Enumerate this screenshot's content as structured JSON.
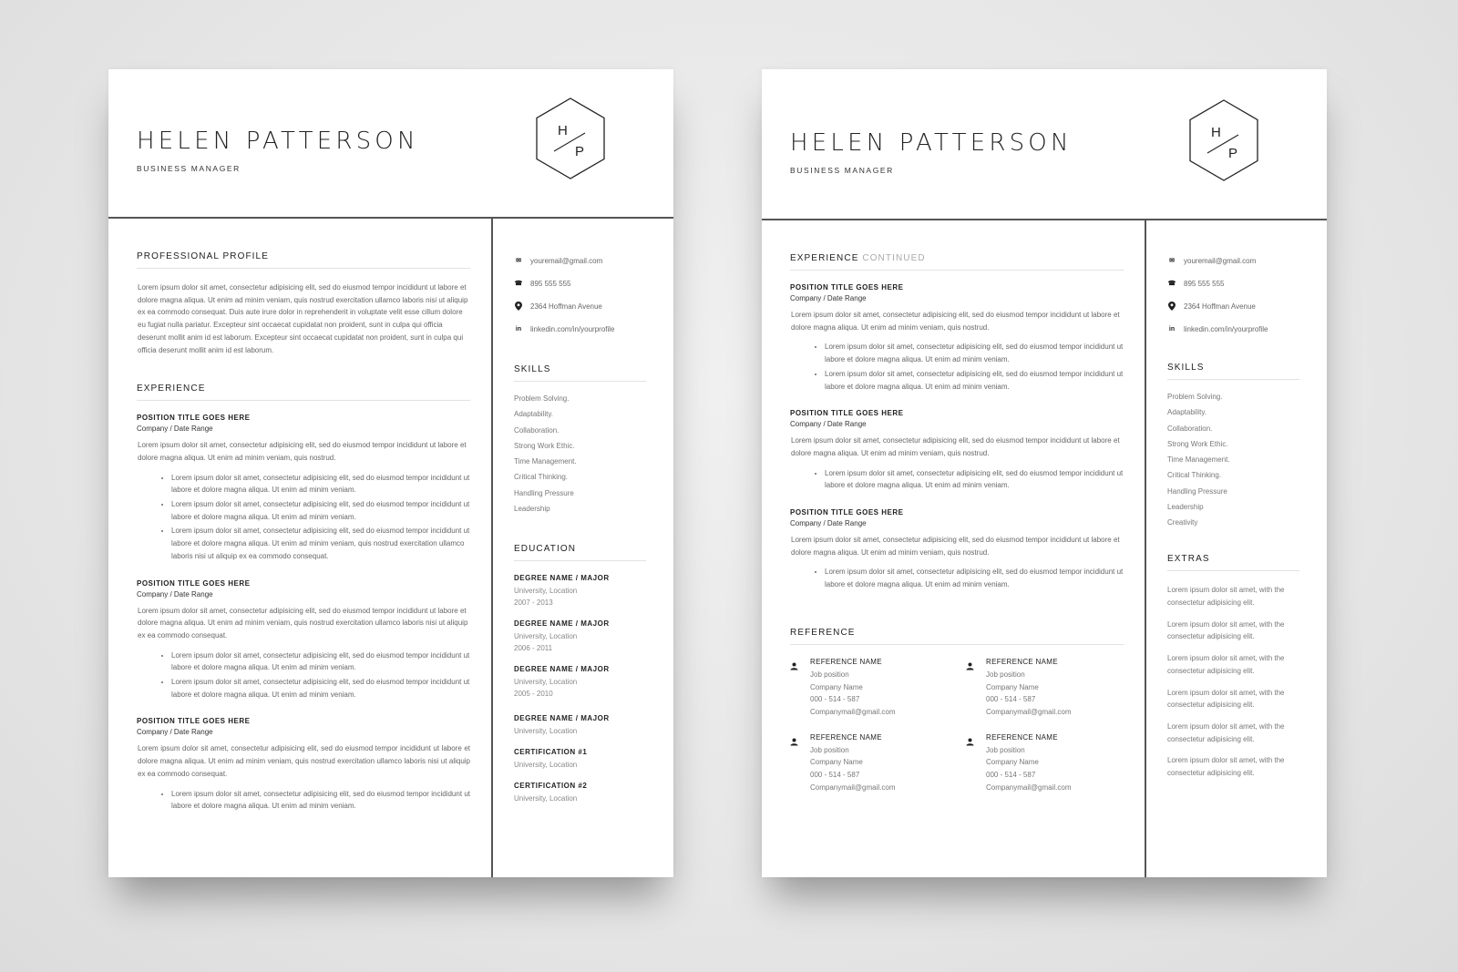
{
  "header": {
    "name": "HELEN PATTERSON",
    "role": "BUSINESS MANAGER",
    "monogram": {
      "first": "H",
      "second": "P"
    }
  },
  "contact": [
    {
      "icon": "email-icon",
      "glyph": "✉",
      "text": "youremail@gmail.com"
    },
    {
      "icon": "phone-icon",
      "glyph": "☎",
      "text": "895 555 555"
    },
    {
      "icon": "location-pin-icon",
      "glyph": "⬤",
      "text": "2364 Hoffman Avenue"
    },
    {
      "icon": "linkedin-icon",
      "glyph": "in",
      "text": "linkedin.com/in/yourprofile"
    }
  ],
  "page1": {
    "profile": {
      "title": "PROFESSIONAL PROFILE",
      "text": "Lorem ipsum dolor sit amet, consectetur adipisicing elit, sed do eiusmod tempor incididunt ut labore et dolore magna aliqua. Ut enim ad minim veniam, quis nostrud exercitation ullamco laboris nisi ut aliquip ex ea commodo consequat. Duis aute irure dolor in reprehenderit in voluptate velit esse cillum dolore eu fugiat nulla pariatur. Excepteur sint occaecat cupidatat non proident, sunt in culpa qui officia deserunt mollit anim id est laborum. Excepteur sint occaecat cupidatat non proident, sunt in culpa qui officia deserunt mollit anim id est laborum."
    },
    "experience": {
      "title": "EXPERIENCE",
      "jobs": [
        {
          "title": "POSITION TITLE GOES HERE",
          "company": "Company / Date Range",
          "summary": "Lorem ipsum dolor sit amet, consectetur adipisicing elit, sed do eiusmod tempor incididunt ut labore et dolore magna aliqua. Ut enim ad minim veniam, quis nostrud.",
          "bullets": [
            "Lorem ipsum dolor sit amet, consectetur adipisicing elit, sed do eiusmod tempor incididunt ut labore et dolore magna aliqua. Ut enim ad minim veniam.",
            "Lorem ipsum dolor sit amet, consectetur adipisicing elit, sed do eiusmod tempor incididunt ut labore et dolore magna aliqua. Ut enim ad minim veniam.",
            "Lorem ipsum dolor sit amet, consectetur adipisicing elit, sed do eiusmod tempor incididunt ut labore et dolore magna aliqua. Ut enim ad minim veniam, quis nostrud exercitation ullamco laboris nisi ut aliquip ex ea commodo consequat."
          ]
        },
        {
          "title": "POSITION TITLE GOES HERE",
          "company": "Company / Date Range",
          "summary": "Lorem ipsum dolor sit amet, consectetur adipisicing elit, sed do eiusmod tempor incididunt ut labore et dolore magna aliqua. Ut enim ad minim veniam, quis nostrud exercitation ullamco laboris nisi ut aliquip ex ea commodo consequat.",
          "bullets": [
            "Lorem ipsum dolor sit amet, consectetur adipisicing elit, sed do eiusmod tempor incididunt ut labore et dolore magna aliqua. Ut enim ad minim veniam.",
            "Lorem ipsum dolor sit amet, consectetur adipisicing elit, sed do eiusmod tempor incididunt ut labore et dolore magna aliqua. Ut enim ad minim veniam."
          ]
        },
        {
          "title": "POSITION TITLE GOES HERE",
          "company": "Company / Date Range",
          "summary": "Lorem ipsum dolor sit amet, consectetur adipisicing elit, sed do eiusmod tempor incididunt ut labore et dolore magna aliqua. Ut enim ad minim veniam, quis nostrud exercitation ullamco laboris nisi ut aliquip ex ea commodo consequat.",
          "bullets": [
            "Lorem ipsum dolor sit amet, consectetur adipisicing elit, sed do eiusmod tempor incididunt ut labore et dolore magna aliqua. Ut enim ad minim veniam."
          ]
        }
      ]
    },
    "skills": {
      "title": "SKILLS",
      "items": [
        "Problem Solving.",
        "Adaptability.",
        "Collaboration.",
        "Strong Work Ethic.",
        "Time Management.",
        "Critical Thinking.",
        "Handling Pressure",
        "Leadership"
      ]
    },
    "education": {
      "title": "EDUCATION",
      "items": [
        {
          "title": "DEGREE NAME / MAJOR",
          "lines": [
            "University, Location",
            "2007 - 2013"
          ]
        },
        {
          "title": "DEGREE NAME / MAJOR",
          "lines": [
            "University, Location",
            "2006 - 2011"
          ]
        },
        {
          "title": "DEGREE NAME / MAJOR",
          "lines": [
            "University, Location",
            "2005 - 2010"
          ]
        },
        {
          "title": "DEGREE NAME / MAJOR",
          "lines": [
            "University, Location"
          ]
        },
        {
          "title": "CERTIFICATION #1",
          "lines": [
            "University, Location"
          ]
        },
        {
          "title": "CERTIFICATION #2",
          "lines": [
            "University, Location"
          ]
        }
      ]
    }
  },
  "page2": {
    "experience": {
      "title": "EXPERIENCE",
      "title_suffix": "CONTINUED",
      "jobs": [
        {
          "title": "POSITION TITLE GOES HERE",
          "company": "Company / Date Range",
          "summary": "Lorem ipsum dolor sit amet, consectetur adipisicing elit, sed do eiusmod tempor incididunt ut labore et dolore magna aliqua. Ut enim ad minim veniam, quis nostrud.",
          "bullets": [
            "Lorem ipsum dolor sit amet, consectetur adipisicing elit, sed do eiusmod tempor incididunt ut labore et dolore magna aliqua. Ut enim ad minim veniam.",
            "Lorem ipsum dolor sit amet, consectetur adipisicing elit, sed do eiusmod tempor incididunt ut labore et dolore magna aliqua. Ut enim ad minim veniam."
          ]
        },
        {
          "title": "POSITION TITLE GOES HERE",
          "company": "Company / Date Range",
          "summary": "Lorem ipsum dolor sit amet, consectetur adipisicing elit, sed do eiusmod tempor incididunt ut labore et dolore magna aliqua. Ut enim ad minim veniam, quis nostrud.",
          "bullets": [
            "Lorem ipsum dolor sit amet, consectetur adipisicing elit, sed do eiusmod tempor incididunt ut labore et dolore magna aliqua. Ut enim ad minim veniam."
          ]
        },
        {
          "title": "POSITION TITLE GOES HERE",
          "company": "Company / Date Range",
          "summary": "Lorem ipsum dolor sit amet, consectetur adipisicing elit, sed do eiusmod tempor incididunt ut labore et dolore magna aliqua. Ut enim ad minim veniam, quis nostrud.",
          "bullets": [
            "Lorem ipsum dolor sit amet, consectetur adipisicing elit, sed do eiusmod tempor incididunt ut labore et dolore magna aliqua. Ut enim ad minim veniam."
          ]
        }
      ]
    },
    "reference": {
      "title": "REFERENCE",
      "items": [
        {
          "name": "REFERENCE NAME",
          "position": "Job position",
          "company": "Company Name",
          "phone": "000 - 514 - 587",
          "email": "Companymail@gmail.com"
        },
        {
          "name": "REFERENCE NAME",
          "position": "Job position",
          "company": "Company Name",
          "phone": "000 - 514 - 587",
          "email": "Companymail@gmail.com"
        },
        {
          "name": "REFERENCE NAME",
          "position": "Job position",
          "company": "Company Name",
          "phone": "000 - 514 - 587",
          "email": "Companymail@gmail.com"
        },
        {
          "name": "REFERENCE NAME",
          "position": "Job position",
          "company": "Company Name",
          "phone": "000 - 514 - 587",
          "email": "Companymail@gmail.com"
        }
      ]
    },
    "skills": {
      "title": "SKILLS",
      "items": [
        "Problem Solving.",
        "Adaptability.",
        "Collaboration.",
        "Strong Work Ethic.",
        "Time Management.",
        "Critical Thinking.",
        "Handling Pressure",
        "Leadership",
        "Creativity"
      ]
    },
    "extras": {
      "title": "EXTRAS",
      "items": [
        "Lorem ipsum dolor sit amet, with the consectetur adipisicing elit.",
        "Lorem ipsum dolor sit amet, with the consectetur adipisicing elit.",
        "Lorem ipsum dolor sit amet, with the consectetur adipisicing elit.",
        "Lorem ipsum dolor sit amet, with the consectetur adipisicing elit.",
        "Lorem ipsum dolor sit amet, with the consectetur adipisicing elit.",
        "Lorem ipsum dolor sit amet, with the consectetur adipisicing elit."
      ]
    }
  }
}
